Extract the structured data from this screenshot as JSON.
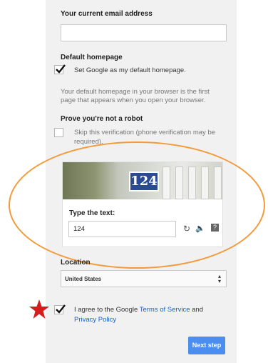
{
  "email": {
    "label": "Your current email address",
    "value": ""
  },
  "homepage": {
    "label": "Default homepage",
    "checkbox_label": "Set Google as my default homepage.",
    "help_line1": "Your default homepage in your browser is the first",
    "help_line2": "page that appears when you open your browser.",
    "checked": true
  },
  "robot": {
    "label": "Prove you're not a robot",
    "skip_line1": "Skip this verification (phone verification may be",
    "skip_line2": "required).",
    "checked": false
  },
  "captcha": {
    "image_text": "124",
    "type_label": "Type the text:",
    "input_value": "124",
    "icons": [
      "refresh-icon",
      "audio-icon",
      "help-icon"
    ]
  },
  "location": {
    "label": "Location",
    "selected": "United States"
  },
  "terms": {
    "prefix": "I agree to the Google",
    "tos_link": "Terms of Service",
    "and": "and",
    "privacy_link": "Privacy Policy",
    "checked": true
  },
  "next_button": "Next step",
  "colors": {
    "accent": "#4c8ef0",
    "annotation_orange": "#f39a3a",
    "star": "#d61d1d",
    "link": "#1a5fc7"
  }
}
